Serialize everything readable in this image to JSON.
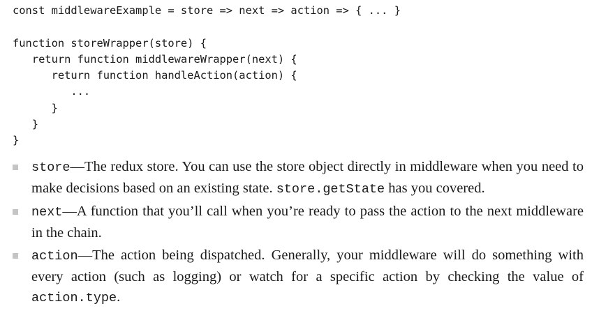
{
  "code": {
    "lines": [
      "const middlewareExample = store => next => action => { ... }",
      "",
      "function storeWrapper(store) {",
      "   return function middlewareWrapper(next) {",
      "      return function handleAction(action) {",
      "         ...",
      "      }",
      "   }",
      "}"
    ]
  },
  "bullets": [
    {
      "term": "store",
      "dash": "—",
      "text": "The redux store. You can use the store object directly in middleware when you need to make decisions based on an existing state. ",
      "code": "store.getState",
      "tail": " has you covered."
    },
    {
      "term": "next",
      "dash": "—",
      "text": "A function that you’ll call when you’re ready to pass the action to the next middleware in the chain.",
      "code": "",
      "tail": ""
    },
    {
      "term": "action",
      "dash": "—",
      "text": "The action being dispatched. Generally, your middleware will do something with every action (such as logging) or watch for a specific action by checking the value of ",
      "code": "action.type",
      "tail": "."
    }
  ]
}
